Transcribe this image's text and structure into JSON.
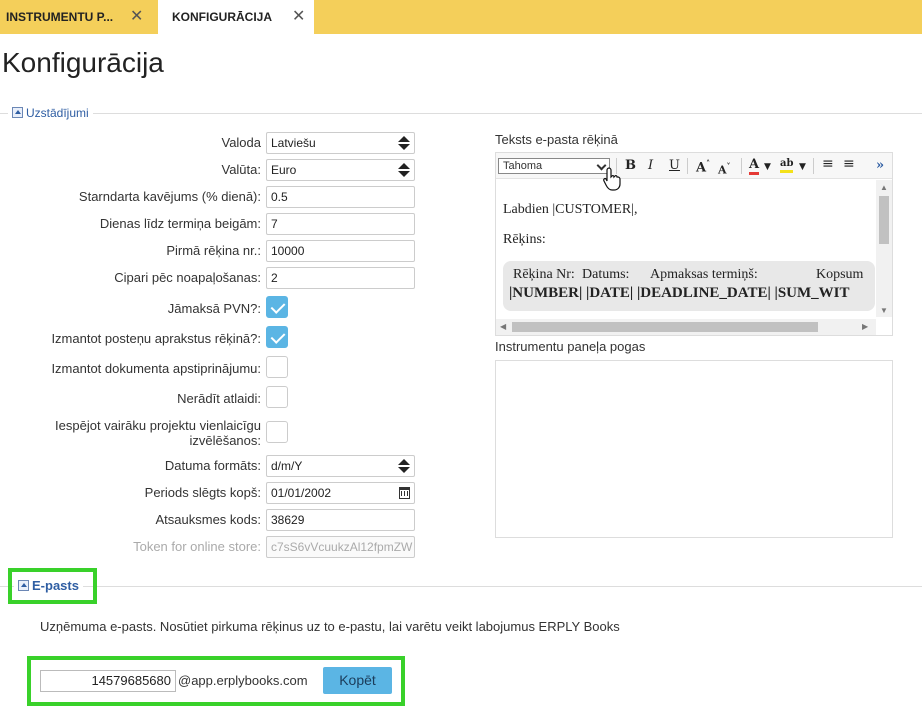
{
  "tabs": [
    {
      "label": "INSTRUMENTU P...",
      "active": false
    },
    {
      "label": "KONFIGURĀCIJA",
      "active": true
    }
  ],
  "page_title": "Konfigurācija",
  "settings": {
    "legend": "Uzstādījumi",
    "fields": [
      {
        "label": "Valoda",
        "value": "Latviešu"
      },
      {
        "label": "Valūta:",
        "value": "Euro"
      },
      {
        "label": "Starndarta kavējums (% dienā):",
        "value": "0.5"
      },
      {
        "label": "Dienas līdz termiņa beigām:",
        "value": "7"
      },
      {
        "label": "Pirmā rēķina nr.:",
        "value": "10000"
      },
      {
        "label": "Cipari pēc noapaļošanas:",
        "value": "2"
      }
    ],
    "checkboxes": [
      {
        "label": "Jāmaksā PVN?:",
        "checked": true
      },
      {
        "label": "Izmantot posteņu aprakstus rēķinā?:",
        "checked": true
      },
      {
        "label": "Izmantot dokumenta apstiprinājumu:",
        "checked": false
      },
      {
        "label": "Nerādīt atlaidi:",
        "checked": false
      },
      {
        "label": "Iespējot vairāku projektu vienlaicīgu izvēlēšanos:",
        "checked": false
      }
    ],
    "date_format": {
      "label": "Datuma formāts:",
      "value": "d/m/Y"
    },
    "period_closed": {
      "label": "Periods slēgts kopš:",
      "value": "01/01/2002"
    },
    "feedback_code": {
      "label": "Atsauksmes kods:",
      "value": "38629"
    },
    "token": {
      "label": "Token for online store:",
      "value": "c7sS6vVcuukzAl12fpmZW"
    }
  },
  "email_text": {
    "label": "Teksts e-pasta rēķinā",
    "font": "Tahoma",
    "toolbar": {
      "bold": "B",
      "italic": "I",
      "underline": "U",
      "grow": "A",
      "shrink": "A",
      "color": "A",
      "highlight": "ab",
      "more": "»"
    },
    "greeting": "Labdien |CUSTOMER|,",
    "invoice_label": "Rēķins:",
    "table_headers": [
      "Rēķina Nr:",
      "Datums:",
      "Apmaksas termiņš:",
      "Kopsum"
    ],
    "table_values": "|NUMBER| |DATE| |DEADLINE_DATE| |SUM_WIT"
  },
  "toolbar_buttons_label": "Instrumentu paneļa pogas",
  "email_section": {
    "legend": "E-pasts",
    "description": "Uzņēmuma e-pasts. Nosūtiet pirkuma rēķinus uz to e-pastu, lai varētu veikt labojumus ERPLY Books",
    "email_prefix": "14579685680",
    "domain": "@app.erplybooks.com",
    "copy_button": "Kopēt"
  },
  "colors": {
    "tab_bar": "#f4cf5a",
    "accent_blue": "#5bb5e4",
    "highlight_green": "#39d12a",
    "link_blue": "#2f5ea3"
  }
}
